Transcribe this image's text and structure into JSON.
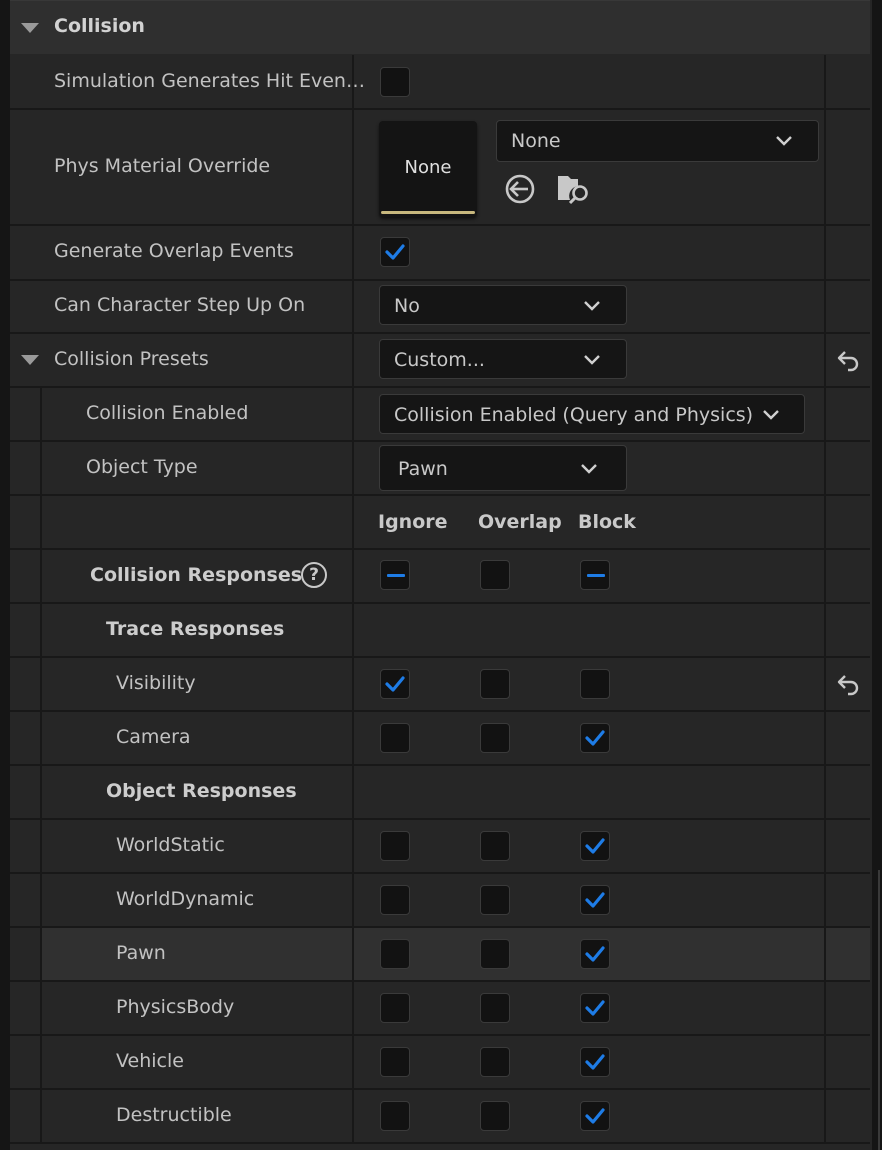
{
  "section": {
    "title": "Collision"
  },
  "props": {
    "sim_hit": {
      "label": "Simulation Generates Hit Even…",
      "checked": false
    },
    "phys_material": {
      "label": "Phys Material Override",
      "thumb_text": "None",
      "dropdown_value": "None"
    },
    "gen_overlap": {
      "label": "Generate Overlap Events",
      "checked": true
    },
    "step_up": {
      "label": "Can Character Step Up On",
      "value": "No"
    },
    "presets": {
      "label": "Collision Presets",
      "value": "Custom..."
    },
    "enabled": {
      "label": "Collision Enabled",
      "value": "Collision Enabled (Query and Physics)"
    },
    "object_type": {
      "label": "Object Type",
      "value": "Pawn"
    }
  },
  "columns": {
    "ignore": "Ignore",
    "overlap": "Overlap",
    "block": "Block"
  },
  "responses": {
    "label": "Collision Responses",
    "help_glyph": "?",
    "state": [
      "mixed",
      "off",
      "mixed"
    ]
  },
  "trace": {
    "label": "Trace Responses",
    "rows": [
      {
        "label": "Visibility",
        "state": [
          true,
          false,
          false
        ]
      },
      {
        "label": "Camera",
        "state": [
          false,
          false,
          true
        ]
      }
    ]
  },
  "object": {
    "label": "Object Responses",
    "rows": [
      {
        "label": "WorldStatic",
        "state": [
          false,
          false,
          true
        ]
      },
      {
        "label": "WorldDynamic",
        "state": [
          false,
          false,
          true
        ]
      },
      {
        "label": "Pawn",
        "state": [
          false,
          false,
          true
        ]
      },
      {
        "label": "PhysicsBody",
        "state": [
          false,
          false,
          true
        ]
      },
      {
        "label": "Vehicle",
        "state": [
          false,
          false,
          true
        ]
      },
      {
        "label": "Destructible",
        "state": [
          false,
          false,
          true
        ]
      }
    ]
  },
  "icons": [
    "triangle-down-icon",
    "chevron-down-icon",
    "checkmark-icon",
    "minus-icon",
    "help-circle-icon",
    "reset-arrow-icon",
    "use-selected-asset-icon",
    "browse-folder-icon"
  ],
  "colors": {
    "accent": "#1e7ce6",
    "background": "#262626",
    "header": "#2f2f2f",
    "field": "#151515"
  }
}
